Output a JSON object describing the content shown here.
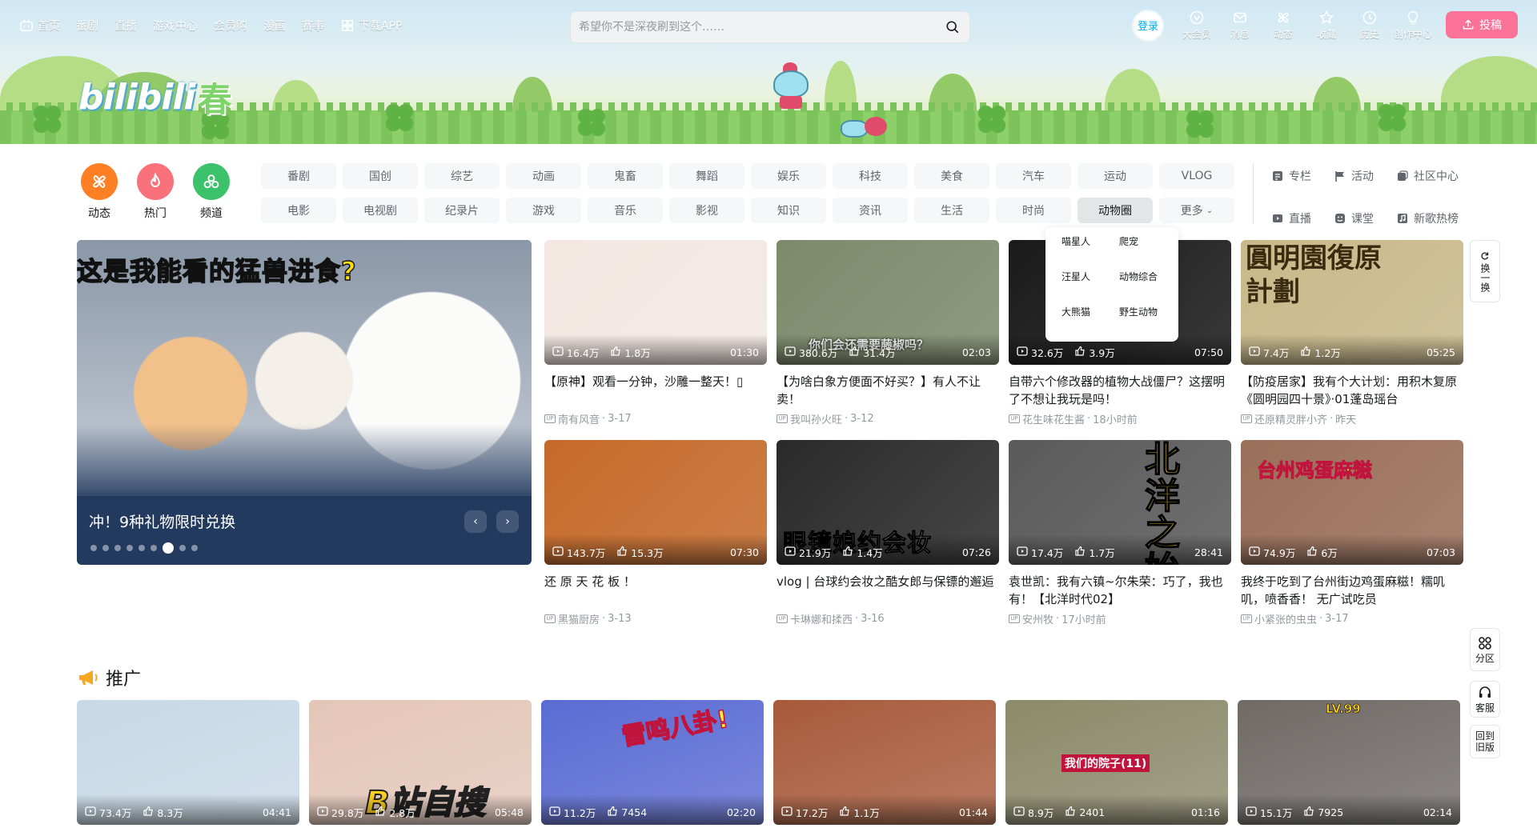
{
  "nav": {
    "left": [
      {
        "label": "首页",
        "icon": "tv-icon"
      },
      {
        "label": "番剧"
      },
      {
        "label": "直播"
      },
      {
        "label": "游戏中心"
      },
      {
        "label": "会员购"
      },
      {
        "label": "漫画"
      },
      {
        "label": "赛事"
      },
      {
        "label": "下载APP",
        "icon": "grid-icon"
      }
    ],
    "search_placeholder": "希望你不是深夜刷到这个……",
    "login": "登录",
    "right": [
      {
        "label": "大会员",
        "icon": "vip-icon"
      },
      {
        "label": "消息",
        "icon": "mail-icon"
      },
      {
        "label": "动态",
        "icon": "wind-icon"
      },
      {
        "label": "收藏",
        "icon": "star-icon"
      },
      {
        "label": "历史",
        "icon": "clock-icon"
      },
      {
        "label": "创作中心",
        "icon": "bulb-icon"
      }
    ],
    "upload": "投稿"
  },
  "banner": {
    "logo": "bilibili",
    "logo_suffix": "春"
  },
  "channels": {
    "big": [
      {
        "label": "动态",
        "color": "#ff7f24"
      },
      {
        "label": "热门",
        "color": "#f9717b"
      },
      {
        "label": "频道",
        "color": "#3cc26a"
      }
    ],
    "tags": [
      "番剧",
      "国创",
      "综艺",
      "动画",
      "鬼畜",
      "舞蹈",
      "娱乐",
      "科技",
      "美食",
      "汽车",
      "运动",
      "VLOG",
      "电影",
      "电视剧",
      "纪录片",
      "游戏",
      "音乐",
      "影视",
      "知识",
      "资讯",
      "生活",
      "时尚",
      "动物圈",
      "更多"
    ],
    "active_tag": "动物圈",
    "shortcuts": [
      "专栏",
      "活动",
      "社区中心",
      "直播",
      "课堂",
      "新歌热榜"
    ],
    "dropdown": [
      "喵星人",
      "爬宠",
      "汪星人",
      "动物综合",
      "大熊猫",
      "野生动物"
    ]
  },
  "carousel": {
    "headline_a": "这是我能看的",
    "headline_b": "猛兽进食",
    "headline_c": "?",
    "caption": "冲！9种礼物限时兑换",
    "dots": 9,
    "active_dot": 6
  },
  "videos": [
    {
      "views": "16.4万",
      "likes": "1.8万",
      "duration": "01:30",
      "title": "【原神】观看一分钟，沙雕一整天！▯",
      "up": "南有风音",
      "date": "3-17",
      "thumb_color": "#f3e7e2"
    },
    {
      "views": "380.6万",
      "likes": "31.4万",
      "duration": "02:03",
      "title": "【为啥白象方便面不好买？】有人不让卖！",
      "up": "我叫孙火旺",
      "date": "3-12",
      "thumb_color": "#7d8a6b",
      "thumb_text": "你们会还需要藤椒吗？"
    },
    {
      "views": "32.6万",
      "likes": "3.9万",
      "duration": "07:50",
      "title": "自带六个修改器的植物大战僵尸？这摆明了不想让我玩是吗！",
      "up": "花生味花生酱",
      "date": "18小时前",
      "thumb_color": "#1a1a1a"
    },
    {
      "views": "7.4万",
      "likes": "1.2万",
      "duration": "05:25",
      "title": "【防疫居家】我有个大计划：用积木复原《圆明园四十景》·01蓬岛瑶台",
      "up": "还原精灵胖小齐",
      "date": "昨天",
      "thumb_color": "#c9b98a",
      "thumb_text": "圓明園復原計劃"
    },
    {
      "views": "143.7万",
      "likes": "15.3万",
      "duration": "07:30",
      "title": "还 原 天 花 板 ！",
      "up": "黑猫厨房",
      "date": "3-13",
      "thumb_color": "#c56a2a"
    },
    {
      "views": "21.9万",
      "likes": "1.4万",
      "duration": "07:26",
      "title": "vlog | 台球约会妆之酷女郎与保镖的邂逅",
      "up": "卡琳娜和揉西",
      "date": "3-16",
      "thumb_color": "#2a2a2a",
      "thumb_text": "眼镜娘约会妆"
    },
    {
      "views": "17.4万",
      "likes": "1.7万",
      "duration": "28:41",
      "title": "袁世凯：我有六镇~尔朱荣：巧了，我也有！【北洋时代02】",
      "up": "安州牧",
      "date": "17小时前",
      "thumb_color": "#5a5a5a",
      "thumb_text": "北洋之始"
    },
    {
      "views": "74.9万",
      "likes": "6万",
      "duration": "07:03",
      "title": "我终于吃到了台州街边鸡蛋麻糍！糯叽叽，喷香香！ 无广试吃员",
      "up": "小紧张的虫虫",
      "date": "3-17",
      "thumb_color": "#9a6f5a",
      "thumb_text": "台州鸡蛋麻糍"
    }
  ],
  "side": {
    "refresh": "换一换",
    "zone": "分区",
    "service": "客服",
    "old": "回到旧版"
  },
  "promo": {
    "title": "推广",
    "items": [
      {
        "views": "73.4万",
        "likes": "8.3万",
        "duration": "04:41",
        "thumb_color": "#c7d9e6"
      },
      {
        "views": "29.8万",
        "likes": "2.8万",
        "duration": "05:48",
        "thumb_color": "#e4c6b8",
        "thumb_text": "B站自搜"
      },
      {
        "views": "11.2万",
        "likes": "7454",
        "duration": "02:20",
        "thumb_color": "#5a6bd3",
        "thumb_text": "雷鸣八卦!"
      },
      {
        "views": "17.2万",
        "likes": "1.1万",
        "duration": "01:44",
        "thumb_color": "#a85a3a"
      },
      {
        "views": "8.9万",
        "likes": "2401",
        "duration": "01:16",
        "thumb_color": "#8c8a6a",
        "thumb_text": "我们的院子(11)"
      },
      {
        "views": "15.1万",
        "likes": "7925",
        "duration": "02:14",
        "thumb_color": "#6f6a66",
        "thumb_text": "LV.99"
      }
    ]
  },
  "colors": {
    "brand_pink": "#fb7299",
    "brand_blue": "#00aeec"
  }
}
